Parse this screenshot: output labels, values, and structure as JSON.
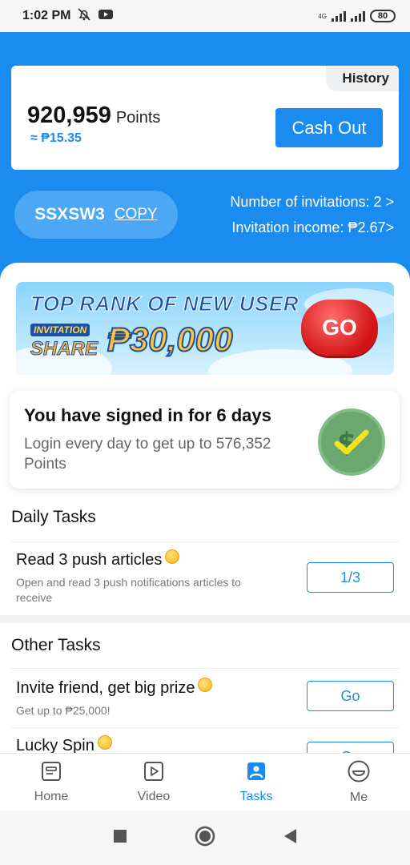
{
  "status_bar": {
    "time": "1:02 PM",
    "network": "4G",
    "battery": "80"
  },
  "points_card": {
    "history_label": "History",
    "points_value": "920,959",
    "points_unit": "Points",
    "peso_value": "≈ ₱15.35",
    "cashout_label": "Cash Out"
  },
  "invite": {
    "code": "SSXSW3",
    "copy_label": "COPY",
    "invitations_text": "Number of invitations: 2 >",
    "income_text": "Invitation income: ₱2.67>"
  },
  "banner": {
    "title": "TOP RANK OF NEW USER",
    "tag_invitation": "INVITATION",
    "tag_share": "SHARE",
    "amount": "₱30,000",
    "go_label": "GO"
  },
  "signin": {
    "title": "You have signed in for 6 days",
    "description": "Login every day to get up to 576,352 Points"
  },
  "daily_tasks": {
    "title": "Daily Tasks",
    "items": [
      {
        "name": "Read 3 push articles",
        "description": "Open and read 3 push notifications articles to receive",
        "button": "1/3"
      }
    ]
  },
  "other_tasks": {
    "title": "Other Tasks",
    "items": [
      {
        "name": "Invite friend, get big prize",
        "description": "Get up to ₱25,000!",
        "button": "Go"
      },
      {
        "name": "Lucky Spin",
        "button": "Go"
      }
    ]
  },
  "bottom_nav": {
    "items": [
      {
        "label": "Home",
        "icon": "home-icon"
      },
      {
        "label": "Video",
        "icon": "video-icon"
      },
      {
        "label": "Tasks",
        "icon": "tasks-icon"
      },
      {
        "label": "Me",
        "icon": "me-icon"
      }
    ],
    "active": "Tasks"
  },
  "colors": {
    "brand_blue": "#1a8cf0",
    "go_red": "#d31414",
    "coin_gold": "#f3b51a"
  }
}
